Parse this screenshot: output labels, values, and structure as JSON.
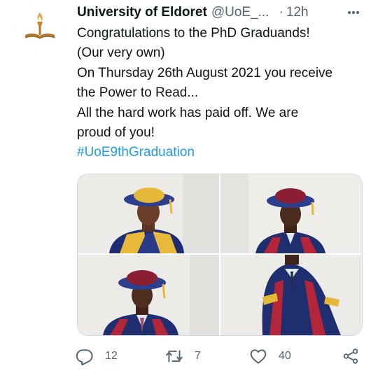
{
  "tweet": {
    "author_name": "University of Eldoret",
    "author_handle": "@UoE_...",
    "separator": "·",
    "time": "12h",
    "text_lines": [
      "Congratulations to the PhD Graduands!",
      "(Our very own)",
      "On Thursday 26th August 2021 you receive",
      "the Power to Read...",
      "All the hard work has paid off. We are",
      "proud of you!"
    ],
    "hashtag": "#UoE9thGraduation"
  },
  "actions": {
    "reply_count": "12",
    "retweet_count": "7",
    "like_count": "40"
  },
  "icons": {
    "more": "more-horizontal-icon",
    "reply": "reply-icon",
    "retweet": "retweet-icon",
    "like": "heart-icon",
    "share": "share-icon"
  },
  "colors": {
    "link": "#1d9bf0",
    "secondary_text": "#536471",
    "border": "#cfd9de"
  }
}
